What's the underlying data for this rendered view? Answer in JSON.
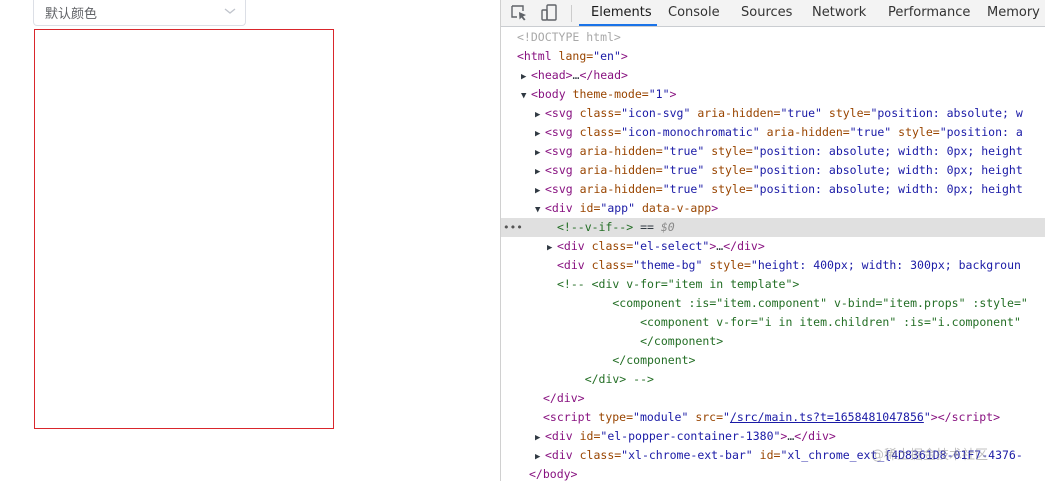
{
  "page": {
    "select_value": "默认颜色"
  },
  "devtools": {
    "tabs": [
      "Elements",
      "Console",
      "Sources",
      "Network",
      "Performance",
      "Memory"
    ],
    "active_tab": "Elements",
    "lines": {
      "l1": "<!DOCTYPE html>",
      "l2a": "<html",
      "l2b": " lang=",
      "l2c": "\"en\"",
      "l2d": ">",
      "l3a": "<head>",
      "l3b": "…",
      "l3c": "</head>",
      "l4a": "<body",
      "l4b": " theme-mode=",
      "l4c": "\"1\"",
      "l4d": ">",
      "l5a": "<svg",
      "l5b": " class=",
      "l5c": "\"icon-svg\"",
      "l5d": " aria-hidden=",
      "l5e": "\"true\"",
      "l5f": " style=",
      "l5g": "\"position: absolute; w",
      "l6a": "<svg",
      "l6b": " class=",
      "l6c": "\"icon-monochromatic\"",
      "l6d": " aria-hidden=",
      "l6e": "\"true\"",
      "l6f": " style=",
      "l6g": "\"position: a",
      "l7a": "<svg",
      "l7b": " aria-hidden=",
      "l7c": "\"true\"",
      "l7d": " style=",
      "l7e": "\"position: absolute; width: 0px; height",
      "l8a": "<svg",
      "l8b": " aria-hidden=",
      "l8c": "\"true\"",
      "l8d": " style=",
      "l8e": "\"position: absolute; width: 0px; height",
      "l9a": "<svg",
      "l9b": " aria-hidden=",
      "l9c": "\"true\"",
      "l9d": " style=",
      "l9e": "\"position: absolute; width: 0px; height",
      "l10a": "<div",
      "l10b": " id=",
      "l10c": "\"app\"",
      "l10d": " data-v-app",
      "l10e": ">",
      "l11a": "<!--v-if-->",
      "l11b": " == ",
      "l11c": "$0",
      "l12a": "<div",
      "l12b": " class=",
      "l12c": "\"el-select\"",
      "l12d": ">",
      "l12e": "…",
      "l12f": "</div>",
      "l13a": "<div",
      "l13b": " class=",
      "l13c": "\"theme-bg\"",
      "l13d": " style=",
      "l13e": "\"height: 400px; width: 300px; backgroun",
      "l14": "<!-- <div v-for=\"item in template\">",
      "l15": "        <component :is=\"item.component\" v-bind=\"item.props\" :style=\"",
      "l16": "            <component v-for=\"i in item.children\" :is=\"i.component\"",
      "l17": "            </component>",
      "l18": "        </component>",
      "l19": "    </div> -->",
      "l20": "</div>",
      "l21a": "<script",
      "l21b": " type=",
      "l21c": "\"module\"",
      "l21d": " src=",
      "l21e": "\"",
      "l21f": "/src/main.ts?t=1658481047856",
      "l21g": "\"",
      "l21h": "></",
      "l21i": "script",
      "l21j": ">",
      "l22a": "<div",
      "l22b": " id=",
      "l22c": "\"el-popper-container-1380\"",
      "l22d": ">",
      "l22e": "…",
      "l22f": "</div>",
      "l23a": "<div",
      "l23b": " class=",
      "l23c": "\"xl-chrome-ext-bar\"",
      "l23d": " id=",
      "l23e": "\"xl_chrome_ext_{4D8361D8-01F7-4376-",
      "l24": "</body>"
    },
    "watermark": "@稀土掘金技术社区"
  },
  "colors": {
    "theme_border": "#d9262c",
    "tab_underline": "#1a73e8",
    "tag": "#881280",
    "attr_name": "#994500",
    "attr_value": "#1a1aa6",
    "comment": "#236e25"
  }
}
